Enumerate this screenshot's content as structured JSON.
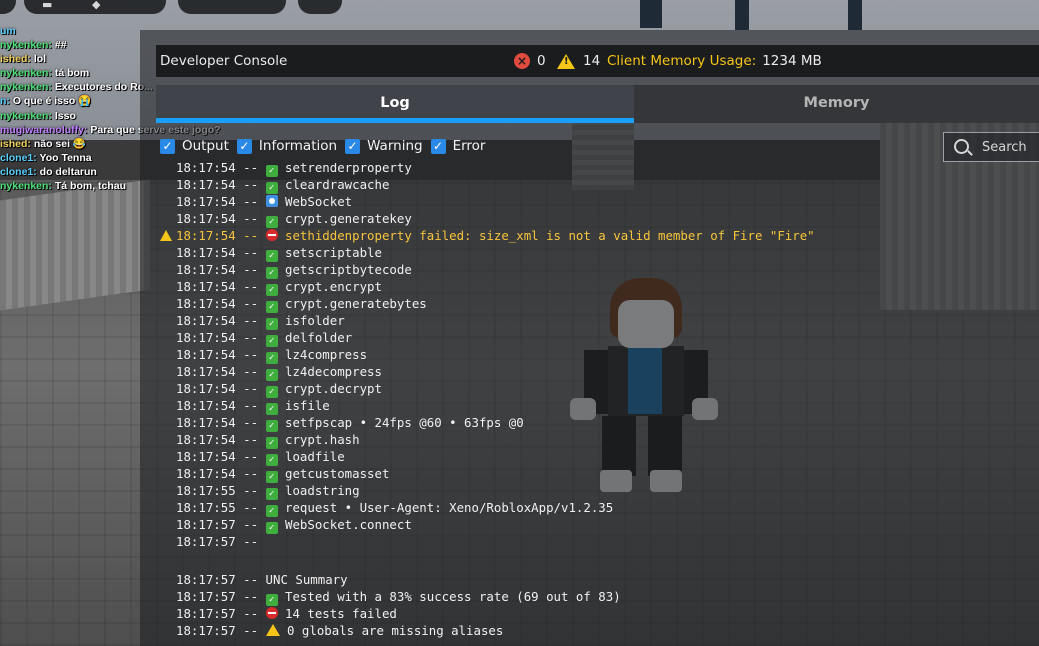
{
  "chat": [
    {
      "name": "um",
      "name_color": "#5ad0ff",
      "message": ""
    },
    {
      "name": "nykenken:",
      "name_color": "#4fe07a",
      "message": "##"
    },
    {
      "name": "ished:",
      "name_color": "#f0d060",
      "message": "lol"
    },
    {
      "name": "nykenken:",
      "name_color": "#4fe07a",
      "message": "tá bom"
    },
    {
      "name": "nykenken:",
      "name_color": "#4fe07a",
      "message": "Executores do Ro..."
    },
    {
      "name": "n:",
      "name_color": "#5ad0ff",
      "message": "O que é isso 😭"
    },
    {
      "name": "nykenken:",
      "name_color": "#4fe07a",
      "message": "Isso"
    },
    {
      "name": "mugiwaranoluffy:",
      "name_color": "#c080ff",
      "message": "Para que serve este jogo?"
    },
    {
      "name": "ished:",
      "name_color": "#f0d060",
      "message": "não sei 😂"
    },
    {
      "name": "clone1:",
      "name_color": "#5ad0ff",
      "message": "Yoo Tenna"
    },
    {
      "name": "clone1:",
      "name_color": "#5ad0ff",
      "message": "do deltarun"
    },
    {
      "name": "nykenken:",
      "name_color": "#4fe07a",
      "message": "Tá bom, tchau"
    }
  ],
  "console": {
    "title": "Developer Console",
    "error_count": "0",
    "warning_count": "14",
    "memory_label": "Client Memory Usage:",
    "memory_value": "1234 MB",
    "tabs": [
      {
        "label": "Log",
        "active": true
      },
      {
        "label": "Memory",
        "active": false
      }
    ],
    "filters": [
      {
        "label": "Output",
        "checked": true
      },
      {
        "label": "Information",
        "checked": true
      },
      {
        "label": "Warning",
        "checked": true
      },
      {
        "label": "Error",
        "checked": true
      }
    ],
    "search_placeholder": "Search",
    "log": [
      {
        "time": "18:17:54",
        "icon": "check",
        "text": "setrenderproperty",
        "type": "output"
      },
      {
        "time": "18:17:54",
        "icon": "check",
        "text": "cleardrawcache",
        "type": "output"
      },
      {
        "time": "18:17:54",
        "icon": "websocket",
        "text": "WebSocket",
        "type": "output"
      },
      {
        "time": "18:17:54",
        "icon": "check",
        "text": "crypt.generatekey",
        "type": "output"
      },
      {
        "time": "18:17:54",
        "icon": "no-entry",
        "text": "sethiddenproperty failed: size_xml is not a valid member of Fire \"Fire\"",
        "type": "warning"
      },
      {
        "time": "18:17:54",
        "icon": "check",
        "text": "setscriptable",
        "type": "output"
      },
      {
        "time": "18:17:54",
        "icon": "check",
        "text": "getscriptbytecode",
        "type": "output"
      },
      {
        "time": "18:17:54",
        "icon": "check",
        "text": "crypt.encrypt",
        "type": "output"
      },
      {
        "time": "18:17:54",
        "icon": "check",
        "text": "crypt.generatebytes",
        "type": "output"
      },
      {
        "time": "18:17:54",
        "icon": "check",
        "text": "isfolder",
        "type": "output"
      },
      {
        "time": "18:17:54",
        "icon": "check",
        "text": "delfolder",
        "type": "output"
      },
      {
        "time": "18:17:54",
        "icon": "check",
        "text": "lz4compress",
        "type": "output"
      },
      {
        "time": "18:17:54",
        "icon": "check",
        "text": "lz4decompress",
        "type": "output"
      },
      {
        "time": "18:17:54",
        "icon": "check",
        "text": "crypt.decrypt",
        "type": "output"
      },
      {
        "time": "18:17:54",
        "icon": "check",
        "text": "isfile",
        "type": "output"
      },
      {
        "time": "18:17:54",
        "icon": "check",
        "text": "setfpscap • 24fps @60 • 63fps @0",
        "type": "output"
      },
      {
        "time": "18:17:54",
        "icon": "check",
        "text": "crypt.hash",
        "type": "output"
      },
      {
        "time": "18:17:54",
        "icon": "check",
        "text": "loadfile",
        "type": "output"
      },
      {
        "time": "18:17:54",
        "icon": "check",
        "text": "getcustomasset",
        "type": "output"
      },
      {
        "time": "18:17:55",
        "icon": "check",
        "text": "loadstring",
        "type": "output"
      },
      {
        "time": "18:17:55",
        "icon": "check",
        "text": "request • User-Agent: Xeno/RobloxApp/v1.2.35",
        "type": "output"
      },
      {
        "time": "18:17:57",
        "icon": "check",
        "text": "WebSocket.connect",
        "type": "output"
      },
      {
        "time": "18:17:57",
        "icon": "none",
        "text": "",
        "type": "output"
      },
      {
        "time": "",
        "icon": "blank",
        "text": "",
        "type": "blank"
      },
      {
        "time": "18:17:57",
        "icon": "none",
        "text": "UNC Summary",
        "type": "output"
      },
      {
        "time": "18:17:57",
        "icon": "check",
        "text": "Tested with a 83% success rate (69 out of 83)",
        "type": "output"
      },
      {
        "time": "18:17:57",
        "icon": "no-entry",
        "text": "14 tests failed",
        "type": "output"
      },
      {
        "time": "18:17:57",
        "icon": "warning",
        "text": "0 globals are missing aliases",
        "type": "output"
      }
    ]
  },
  "colors": {
    "accent_blue": "#19a0ff",
    "warning_yellow": "#f5c518",
    "error_red": "#e04a3f",
    "check_green": "#3fae3f"
  }
}
